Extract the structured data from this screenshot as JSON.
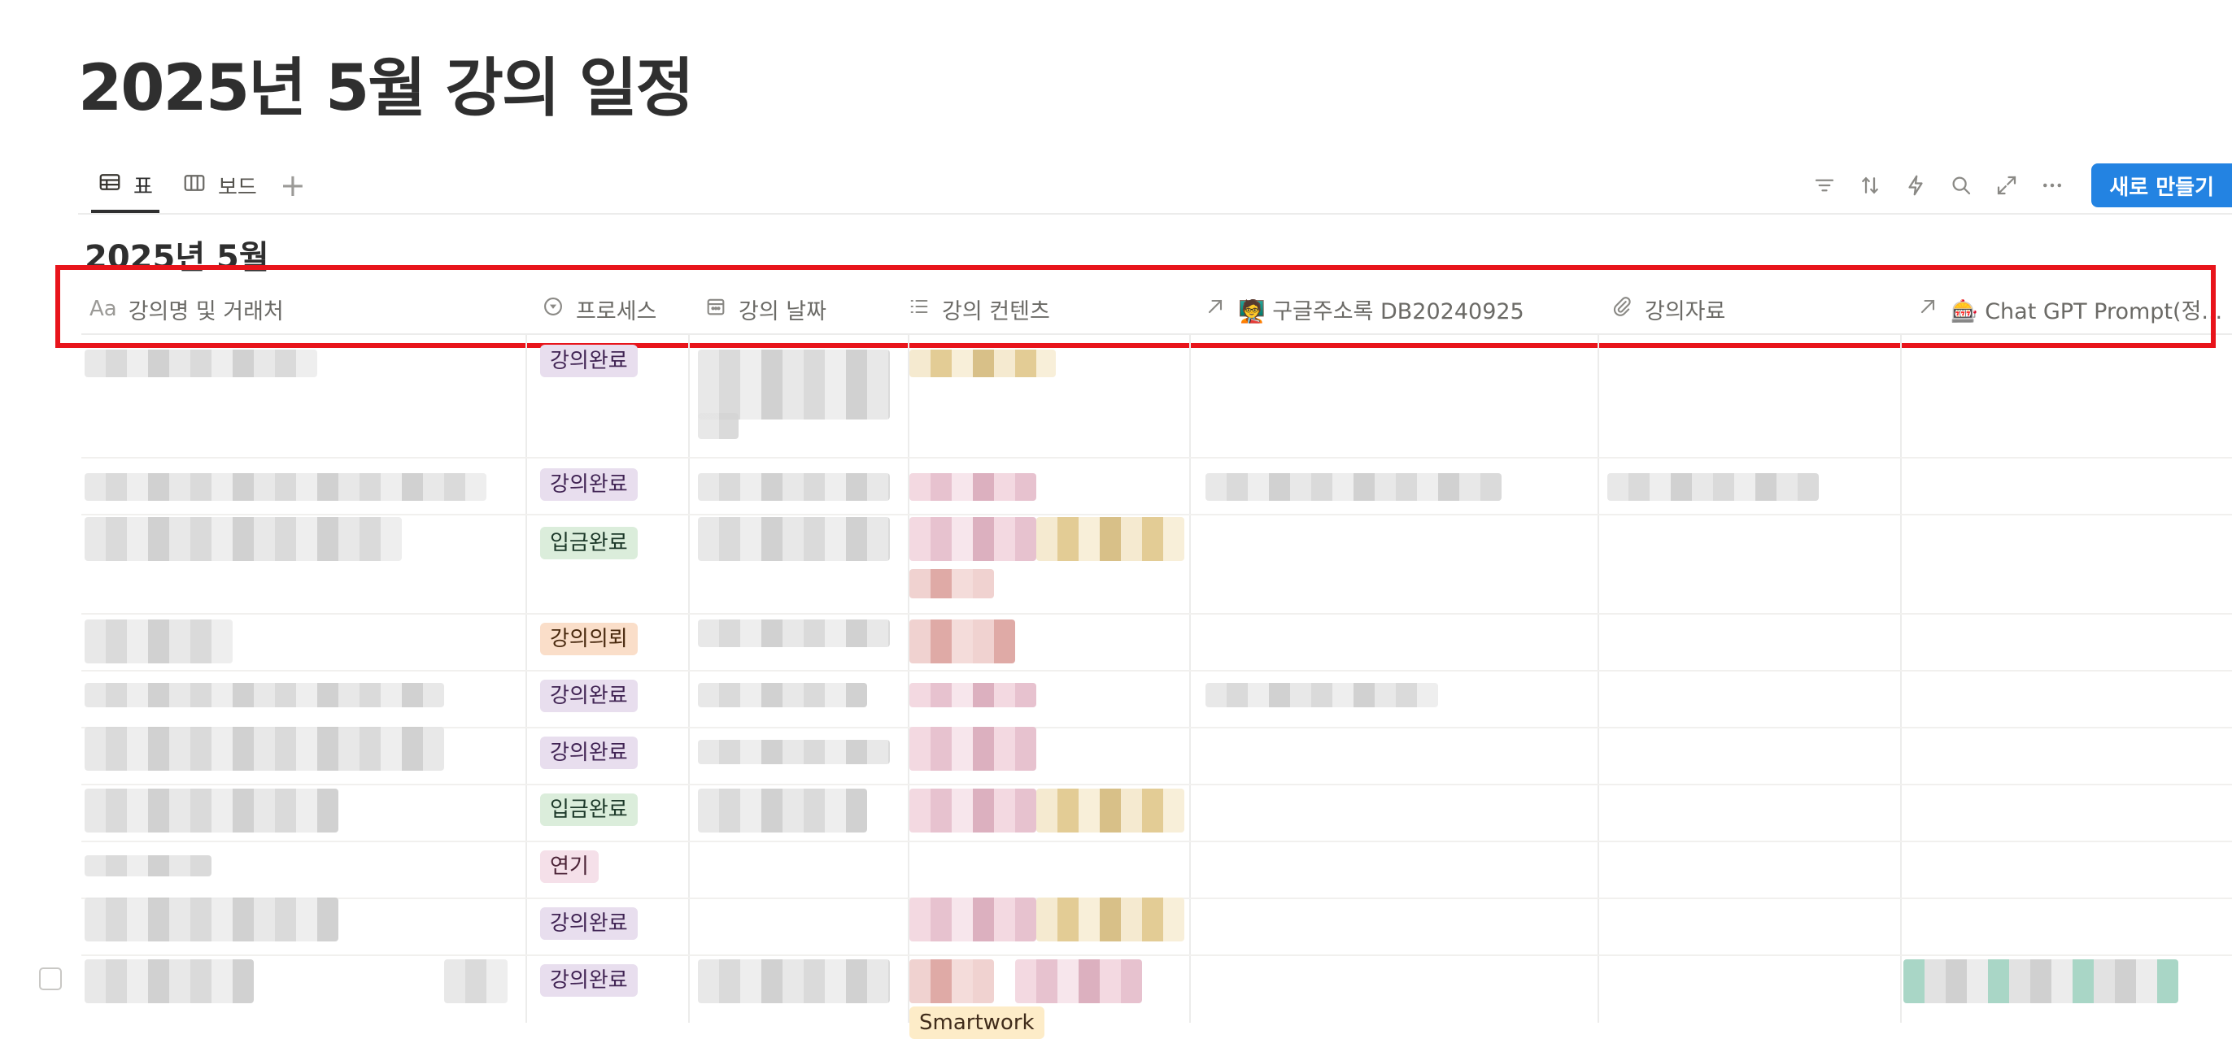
{
  "page": {
    "title": "2025년 5월 강의 일정"
  },
  "views": {
    "tabs": [
      {
        "label": "표",
        "icon": "table-icon",
        "active": true
      },
      {
        "label": "보드",
        "icon": "board-icon",
        "active": false
      }
    ],
    "add_icon": "plus-icon"
  },
  "toolbar": {
    "icons": [
      "filter-icon",
      "sort-icon",
      "automation-lightning-icon",
      "search-icon",
      "expand-icon",
      "more-icon"
    ],
    "new_button_label": "새로 만들기"
  },
  "group": {
    "title": "2025년 5월"
  },
  "columns": [
    {
      "label": "강의명 및 거래처",
      "prefix": "Aa",
      "icon": "title-property-icon"
    },
    {
      "label": "프로세스",
      "icon": "status-icon"
    },
    {
      "label": "강의 날짜",
      "icon": "calendar-icon"
    },
    {
      "label": "강의 컨텐츠",
      "icon": "list-icon"
    },
    {
      "label": "🧑‍🏫 구글주소록 DB20240925",
      "icon": "relation-arrow-icon"
    },
    {
      "label": "강의자료",
      "icon": "paperclip-icon"
    },
    {
      "label": "🎰 Chat GPT Prompt(정...",
      "icon": "relation-arrow-icon"
    }
  ],
  "rows": [
    {
      "status": "강의완료",
      "status_color": "purple"
    },
    {
      "status": "강의완료",
      "status_color": "purple"
    },
    {
      "status": "입금완료",
      "status_color": "green"
    },
    {
      "status": "강의의뢰",
      "status_color": "orange"
    },
    {
      "status": "강의완료",
      "status_color": "purple"
    },
    {
      "status": "강의완료",
      "status_color": "purple"
    },
    {
      "status": "입금완료",
      "status_color": "green"
    },
    {
      "status": "연기",
      "status_color": "pink"
    },
    {
      "status": "강의완료",
      "status_color": "purple"
    },
    {
      "status": "강의완료",
      "status_color": "purple",
      "extra_tag": "Smartwork"
    }
  ],
  "colors": {
    "accent": "#2383e2",
    "highlight": "#e8141b"
  }
}
